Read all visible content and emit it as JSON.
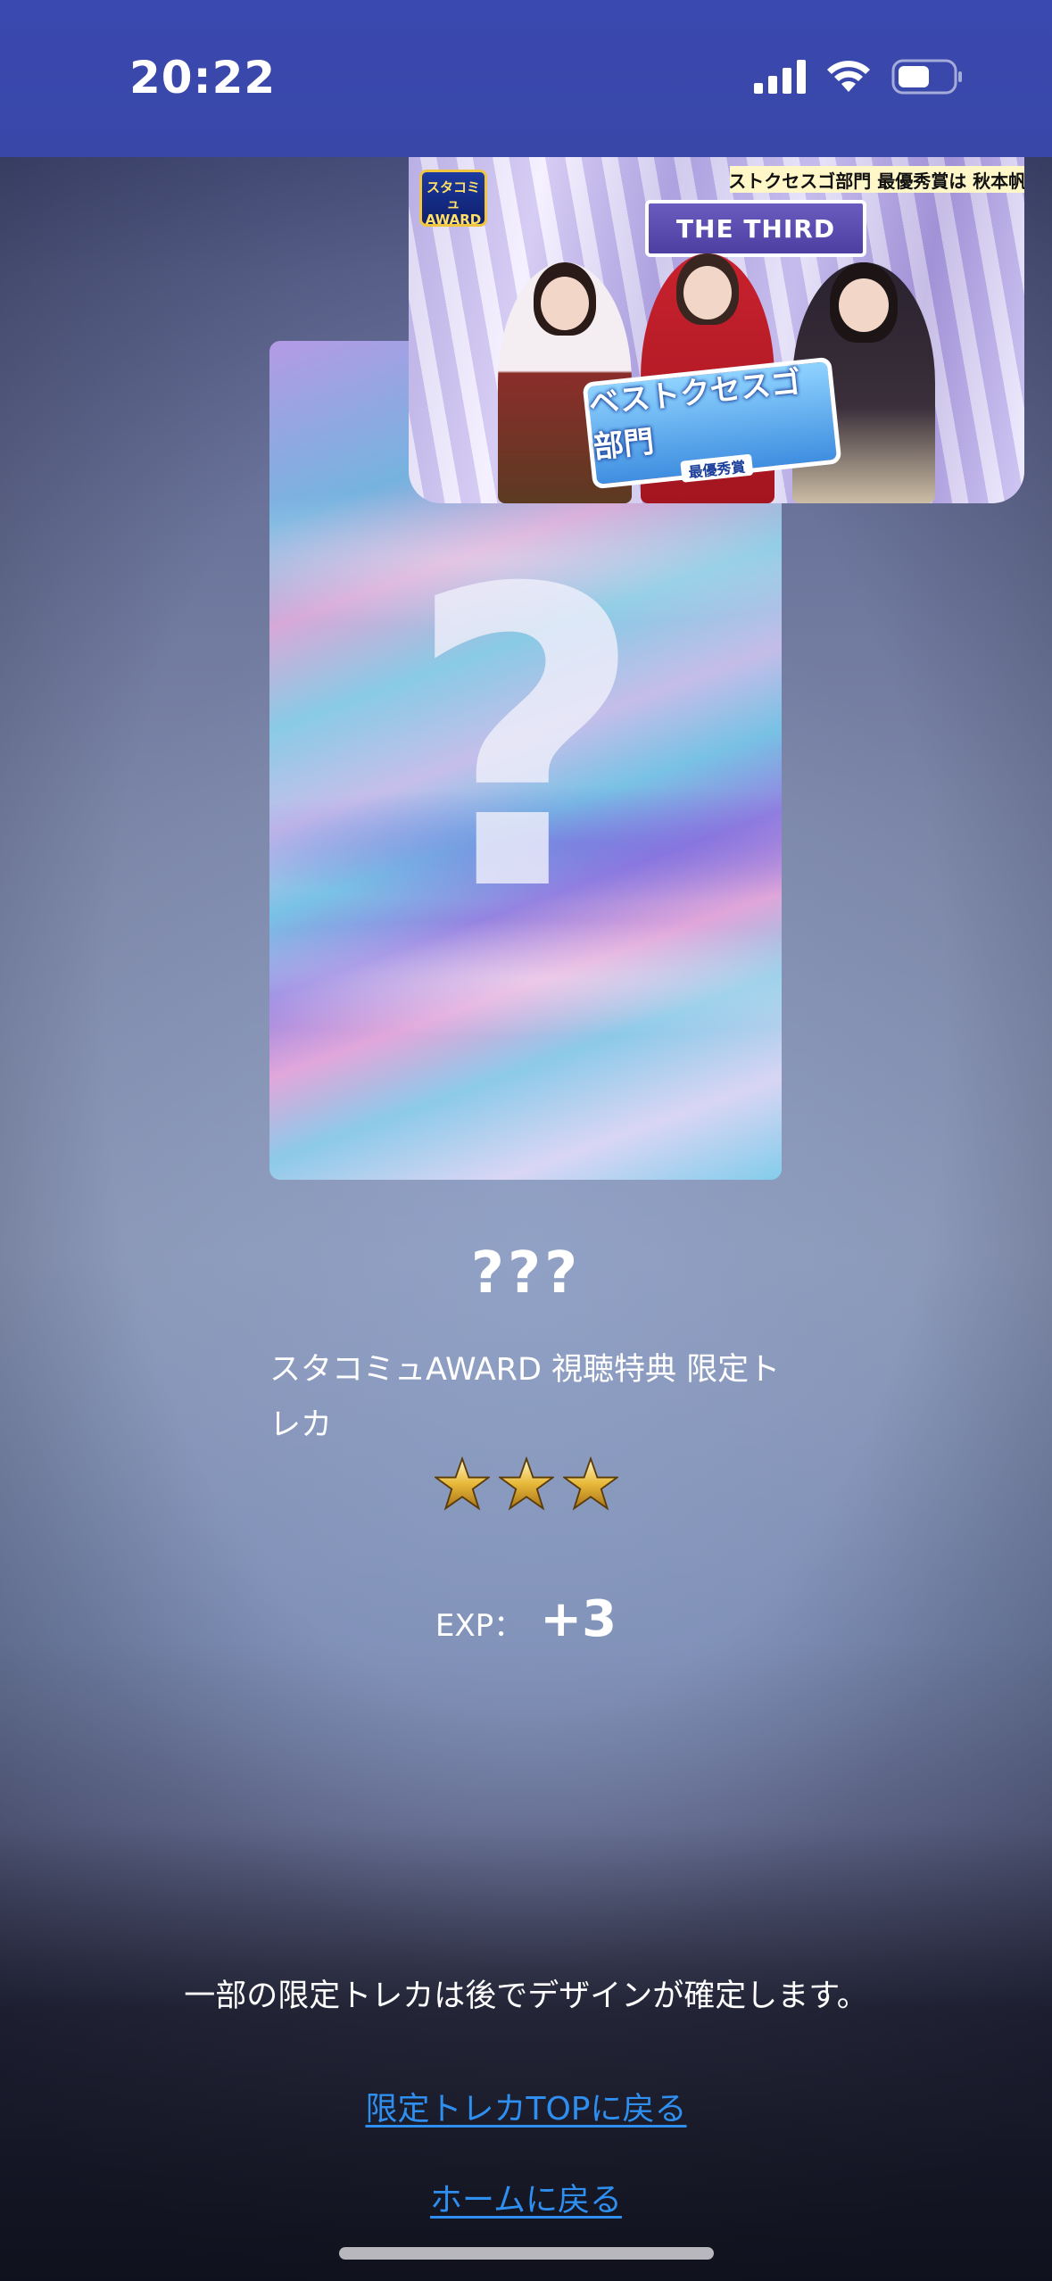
{
  "status_bar": {
    "time": "20:22",
    "icons": [
      "signal-icon",
      "wifi-icon",
      "battery-icon"
    ]
  },
  "video": {
    "headline": "ベストクセスゴ部門 最優秀賞は 秋本帆華",
    "banner": "THE THIRD",
    "logo": "スタコミュ AWARD",
    "sign_title": "ベストクセスゴ部門",
    "sign_sub": "最優秀賞"
  },
  "card": {
    "placeholder_mark": "?",
    "name": "???",
    "description": "スタコミュAWARD 視聴特典 限定トレカ",
    "stars": 3,
    "exp_label": "EXP：",
    "exp_value": "+3"
  },
  "notice": "一部の限定トレカは後でデザインが確定します。",
  "links": {
    "back_to_top": "限定トレカTOPに戻る",
    "back_to_home": "ホームに戻る"
  },
  "colors": {
    "status_bar": "#3947a8",
    "link": "#2f8ff0",
    "star": "#e8b93a"
  }
}
